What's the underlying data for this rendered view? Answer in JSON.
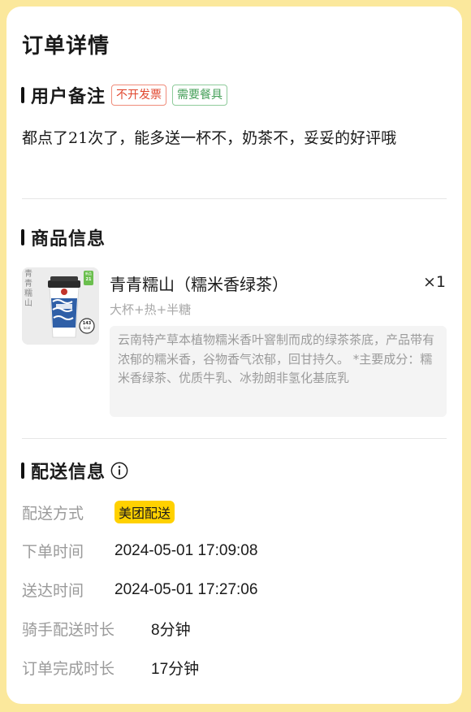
{
  "page": {
    "title": "订单详情"
  },
  "user_remark": {
    "section_title": "用户备注",
    "tags": [
      "不开发票",
      "需要餐具"
    ],
    "text": "都点了21次了，能多送一杯不，奶茶不，妥妥的好评哦"
  },
  "goods": {
    "section_title": "商品信息",
    "item": {
      "name": "青青糯山（糯米香绿茶）",
      "quantity": "×1",
      "spec": "大杯+热+半糖",
      "description": "云南特产草本植物糯米香叶窨制而成的绿茶茶底，产品带有浓郁的糯米香，谷物香气浓郁，回甘持久。 *主要成分：糯米香绿茶、优质牛乳、冰勃朗非氢化基底乳",
      "image": {
        "side_text": "青青糯山",
        "badge_top": "新品",
        "badge_num": "21",
        "kcal_num": "143",
        "kcal_unit": "kcal"
      }
    }
  },
  "delivery": {
    "section_title": "配送信息",
    "rows": [
      {
        "label": "配送方式",
        "value": "美团配送"
      },
      {
        "label": "下单时间",
        "value": "2024-05-01 17:09:08"
      },
      {
        "label": "送达时间",
        "value": "2024-05-01 17:27:06"
      },
      {
        "label": "骑手配送时长",
        "value": "8分钟"
      },
      {
        "label": "订单完成时长",
        "value": "17分钟"
      }
    ]
  },
  "colors": {
    "page_background": "#fbe89c",
    "tag_red": "#e0462d",
    "tag_green": "#46a05a",
    "delivery_badge": "#ffd100"
  },
  "icons": {
    "info": "info-circle-icon"
  }
}
